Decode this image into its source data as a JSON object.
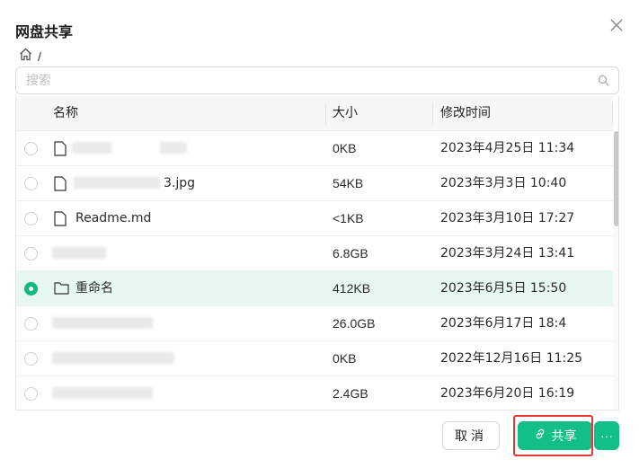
{
  "dialog": {
    "title": "网盘共享",
    "close_icon": "close-icon"
  },
  "breadcrumb": {
    "home_icon": "home-icon",
    "separator": "/"
  },
  "search": {
    "placeholder": "搜索",
    "value": "",
    "icon": "search-icon"
  },
  "table": {
    "columns": [
      "名称",
      "大小",
      "修改时间"
    ],
    "rows": [
      {
        "name": "",
        "size": "0KB",
        "modified": "2023年4月25日 11:34",
        "selected": false,
        "icon": "file-icon"
      },
      {
        "name": "3.jpg",
        "size": "54KB",
        "modified": "2023年3月3日 10:40",
        "selected": false,
        "icon": "file-icon"
      },
      {
        "name": "Readme.md",
        "size": "<1KB",
        "modified": "2023年3月10日 17:27",
        "selected": false,
        "icon": "file-icon"
      },
      {
        "name": "",
        "size": "6.8GB",
        "modified": "2023年3月24日 13:41",
        "selected": false,
        "icon": ""
      },
      {
        "name": "重命名",
        "size": "412KB",
        "modified": "2023年6月5日 15:50",
        "selected": true,
        "icon": "folder-icon"
      },
      {
        "name": "",
        "size": "26.0GB",
        "modified": "2023年6月17日 18:4",
        "selected": false,
        "icon": ""
      },
      {
        "name": "",
        "size": "0KB",
        "modified": "2022年12月16日 11:25",
        "selected": false,
        "icon": ""
      },
      {
        "name": "",
        "size": "2.4GB",
        "modified": "2023年6月20日 16:19",
        "selected": false,
        "icon": ""
      }
    ]
  },
  "footer": {
    "cancel_label": "取消",
    "share_label": "共享",
    "share_icon": "link-icon",
    "more_label": "···",
    "more_icon": "more-icon"
  },
  "colors": {
    "accent": "#12bf86",
    "selected_row": "#e7f8f0",
    "highlight": "#e53935"
  }
}
